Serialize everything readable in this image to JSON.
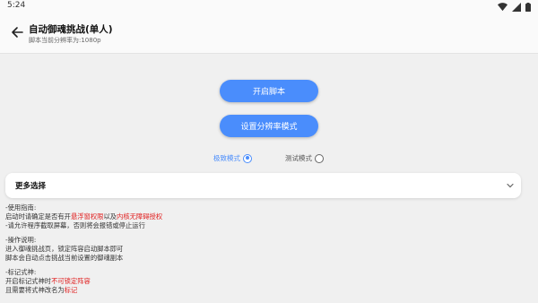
{
  "statusbar": {
    "time": "5:24"
  },
  "appbar": {
    "title": "自动御魂挑战(单人)",
    "subtitle": "脚本当前分辨率为:1080p"
  },
  "buttons": {
    "start": "开启脚本",
    "resolution": "设置分辨率模式"
  },
  "modes": [
    {
      "label": "极致模式",
      "selected": true
    },
    {
      "label": "测试模式",
      "selected": false
    }
  ],
  "more": {
    "label": "更多选择"
  },
  "notes": {
    "usage_title": "-使用指南:",
    "usage_l1_a": "启动时请确定是否有开",
    "usage_l1_b": "悬浮窗权限",
    "usage_l1_c": "以及",
    "usage_l1_d": "内核无障碍授权",
    "usage_l2": "-请允许程序截取屏幕，否则将会报错或停止运行",
    "op_title": "-操作说明:",
    "op_l1": "进入御魂挑战页，锁定阵容启动脚本即可",
    "op_l2": "脚本会自动点击挑战当前设置的御魂副本",
    "mark_title": "-标记式神:",
    "mark_l1_a": "开启标记式神时",
    "mark_l1_b": "不可锁定阵容",
    "mark_l2_a": "且需要将式神改名为",
    "mark_l2_b": "标记"
  },
  "colors": {
    "accent": "#4a8dfc",
    "warning": "#e02020",
    "background": "#f0f0f0"
  },
  "icons": {
    "back": "arrow-left-icon",
    "expand": "chevron-down-icon",
    "wifi": "wifi-icon",
    "signal": "signal-icon",
    "battery": "battery-icon"
  }
}
